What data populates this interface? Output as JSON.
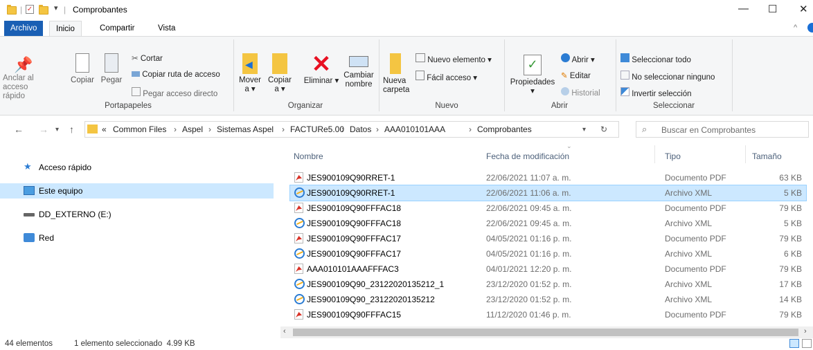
{
  "window": {
    "title": "Comprobantes",
    "minimize": "—",
    "maximize": "☐",
    "close": "✕"
  },
  "tabs": [
    "Archivo",
    "Inicio",
    "Compartir",
    "Vista"
  ],
  "ribbon": {
    "portapapeles": {
      "label": "Portapapeles",
      "pin": "Anclar al acceso rápido",
      "copy": "Copiar",
      "paste": "Pegar",
      "cut": "Cortar",
      "copy_path": "Copiar ruta de acceso",
      "paste_shortcut": "Pegar acceso directo"
    },
    "organizar": {
      "label": "Organizar",
      "move": "Mover a ▾",
      "copy_to": "Copiar a ▾",
      "delete": "Eliminar ▾",
      "rename": "Cambiar nombre"
    },
    "nuevo": {
      "label": "Nuevo",
      "new_folder": "Nueva carpeta",
      "new_item": "Nuevo elemento ▾",
      "easy_access": "Fácil acceso ▾"
    },
    "abrir": {
      "label": "Abrir",
      "properties": "Propiedades",
      "open": "Abrir ▾",
      "edit": "Editar",
      "history": "Historial"
    },
    "seleccionar": {
      "label": "Seleccionar",
      "select_all": "Seleccionar todo",
      "select_none": "No seleccionar ninguno",
      "invert": "Invertir selección"
    }
  },
  "address": {
    "crumbs": [
      "«",
      "Common Files",
      "Aspel",
      "Sistemas Aspel",
      "FACTURe5.00",
      "Datos",
      "AAA010101AAA",
      "Comprobantes"
    ],
    "search_placeholder": "Buscar en Comprobantes"
  },
  "nav": [
    {
      "label": "Acceso rápido",
      "icon": "star-icon"
    },
    {
      "label": "Este equipo",
      "icon": "computer-icon"
    },
    {
      "label": "DD_EXTERNO (E:)",
      "icon": "drive-icon"
    },
    {
      "label": "Red",
      "icon": "network-icon"
    }
  ],
  "columns": {
    "name": "Nombre",
    "date": "Fecha de modificación",
    "type": "Tipo",
    "size": "Tamaño"
  },
  "files": [
    {
      "name": "JES900109Q90RRET-1",
      "date": "22/06/2021 11:07 a. m.",
      "type": "Documento PDF",
      "size": "63 KB",
      "icon": "pdf"
    },
    {
      "name": "JES900109Q90RRET-1",
      "date": "22/06/2021 11:06 a. m.",
      "type": "Archivo XML",
      "size": "5 KB",
      "icon": "xml"
    },
    {
      "name": "JES900109Q90FFFAC18",
      "date": "22/06/2021 09:45 a. m.",
      "type": "Documento PDF",
      "size": "79 KB",
      "icon": "pdf"
    },
    {
      "name": "JES900109Q90FFFAC18",
      "date": "22/06/2021 09:45 a. m.",
      "type": "Archivo XML",
      "size": "5 KB",
      "icon": "xml"
    },
    {
      "name": "JES900109Q90FFFAC17",
      "date": "04/05/2021 01:16 p. m.",
      "type": "Documento PDF",
      "size": "79 KB",
      "icon": "pdf"
    },
    {
      "name": "JES900109Q90FFFAC17",
      "date": "04/05/2021 01:16 p. m.",
      "type": "Archivo XML",
      "size": "6 KB",
      "icon": "xml"
    },
    {
      "name": "AAA010101AAAFFFAC3",
      "date": "04/01/2021 12:20 p. m.",
      "type": "Documento PDF",
      "size": "79 KB",
      "icon": "pdf"
    },
    {
      "name": "JES900109Q90_23122020135212_1",
      "date": "23/12/2020 01:52 p. m.",
      "type": "Archivo XML",
      "size": "17 KB",
      "icon": "xml"
    },
    {
      "name": "JES900109Q90_23122020135212",
      "date": "23/12/2020 01:52 p. m.",
      "type": "Archivo XML",
      "size": "14 KB",
      "icon": "xml"
    },
    {
      "name": "JES900109Q90FFFAC15",
      "date": "11/12/2020 01:46 p. m.",
      "type": "Documento PDF",
      "size": "79 KB",
      "icon": "pdf"
    }
  ],
  "status": {
    "count": "44 elementos",
    "selection": "1 elemento seleccionado  4.99 KB"
  }
}
